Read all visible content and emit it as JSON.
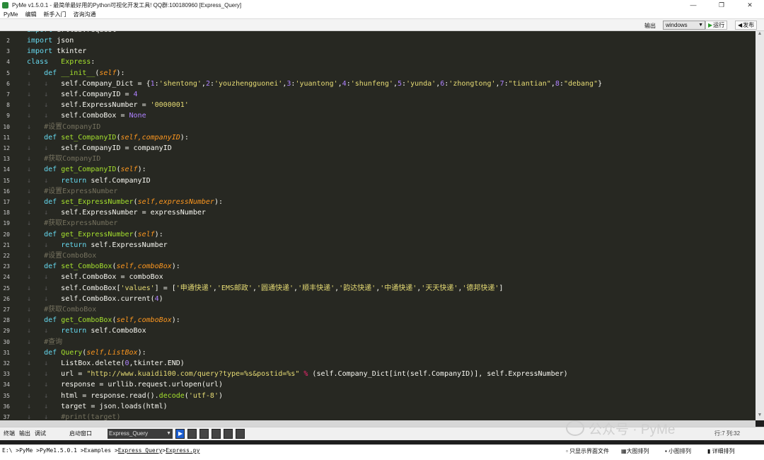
{
  "window": {
    "title": "PyMe v1.5.0.1 - 最简单最好用的Python可视化开发工具! QQ群:100180960   [Express_Query]",
    "minimize": "—",
    "maximize": "❐",
    "close": "✕"
  },
  "menu": [
    "PyMe",
    "编辑",
    "新手入门",
    "咨询沟通"
  ],
  "toolbar": {
    "output_label": "输出",
    "platform": "windows",
    "run_label": "运行",
    "publish_label": "发布"
  },
  "code_lines": [
    {
      "n": "2",
      "indent": 0,
      "html": "<span class='tok-kw'>import</span> json"
    },
    {
      "n": "3",
      "indent": 0,
      "html": "<span class='tok-kw'>import</span> tkinter"
    },
    {
      "n": "4",
      "indent": 0,
      "html": "<span class='tok-kw'>class</span>   <span class='tok-fn'>Express</span>:"
    },
    {
      "n": "5",
      "indent": 1,
      "html": "<span class='tok-kw'>def</span> <span class='tok-fn'>__init__</span>(<span class='tok-self'>self</span>):"
    },
    {
      "n": "6",
      "indent": 2,
      "html": "self.Company_Dict = {<span class='tok-num'>1</span>:<span class='tok-str'>'shentong'</span>,<span class='tok-num'>2</span>:<span class='tok-str'>'youzhengguonei'</span>,<span class='tok-num'>3</span>:<span class='tok-str'>'yuantong'</span>,<span class='tok-num'>4</span>:<span class='tok-str'>'shunfeng'</span>,<span class='tok-num'>5</span>:<span class='tok-str'>'yunda'</span>,<span class='tok-num'>6</span>:<span class='tok-str'>'zhongtong'</span>,<span class='tok-num'>7</span>:<span class='tok-str'>\"tiantian\"</span>,<span class='tok-num'>8</span>:<span class='tok-str'>\"debang\"</span>}"
    },
    {
      "n": "7",
      "indent": 2,
      "html": "self.CompanyID = <span class='tok-num'>4</span>"
    },
    {
      "n": "8",
      "indent": 2,
      "html": "self.ExpressNumber = <span class='tok-str'>'0000001'</span>"
    },
    {
      "n": "9",
      "indent": 2,
      "html": "self.ComboBox = <span class='tok-num'>None</span>"
    },
    {
      "n": "10",
      "indent": 1,
      "html": "<span class='tok-cm'>#设置CompanyID</span>"
    },
    {
      "n": "11",
      "indent": 1,
      "html": "<span class='tok-kw'>def</span> <span class='tok-fn'>set_CompanyID</span>(<span class='tok-self'>self,companyID</span>):"
    },
    {
      "n": "12",
      "indent": 2,
      "html": "self.CompanyID = companyID"
    },
    {
      "n": "13",
      "indent": 1,
      "html": "<span class='tok-cm'>#获取CompanyID</span>"
    },
    {
      "n": "14",
      "indent": 1,
      "html": "<span class='tok-kw'>def</span> <span class='tok-fn'>get_CompanyID</span>(<span class='tok-self'>self</span>):"
    },
    {
      "n": "15",
      "indent": 2,
      "html": "<span class='tok-kw'>return</span> self.CompanyID"
    },
    {
      "n": "16",
      "indent": 1,
      "html": "<span class='tok-cm'>#设置ExpressNumber</span>"
    },
    {
      "n": "17",
      "indent": 1,
      "html": "<span class='tok-kw'>def</span> <span class='tok-fn'>set_ExpressNumber</span>(<span class='tok-self'>self,expressNumber</span>):"
    },
    {
      "n": "18",
      "indent": 2,
      "html": "self.ExpressNumber = expressNumber"
    },
    {
      "n": "19",
      "indent": 1,
      "html": "<span class='tok-cm'>#获取ExpressNumber</span>"
    },
    {
      "n": "20",
      "indent": 1,
      "html": "<span class='tok-kw'>def</span> <span class='tok-fn'>get_ExpressNumber</span>(<span class='tok-self'>self</span>):"
    },
    {
      "n": "21",
      "indent": 2,
      "html": "<span class='tok-kw'>return</span> self.ExpressNumber"
    },
    {
      "n": "22",
      "indent": 1,
      "html": "<span class='tok-cm'>#设置ComboBox</span>"
    },
    {
      "n": "23",
      "indent": 1,
      "html": "<span class='tok-kw'>def</span> <span class='tok-fn'>set_ComboBox</span>(<span class='tok-self'>self,comboBox</span>):"
    },
    {
      "n": "24",
      "indent": 2,
      "html": "self.ComboBox = comboBox"
    },
    {
      "n": "25",
      "indent": 2,
      "html": "self.ComboBox[<span class='tok-str'>'values'</span>] = [<span class='tok-str'>'申通快递'</span>,<span class='tok-str'>'EMS邮政'</span>,<span class='tok-str'>'圆通快递'</span>,<span class='tok-str'>'顺丰快递'</span>,<span class='tok-str'>'韵达快递'</span>,<span class='tok-str'>'中通快递'</span>,<span class='tok-str'>'天天快递'</span>,<span class='tok-str'>'德邦快递'</span>]"
    },
    {
      "n": "26",
      "indent": 2,
      "html": "self.ComboBox.current(<span class='tok-num'>4</span>)"
    },
    {
      "n": "27",
      "indent": 1,
      "html": "<span class='tok-cm'>#获取ComboBox</span>"
    },
    {
      "n": "28",
      "indent": 1,
      "html": "<span class='tok-kw'>def</span> <span class='tok-fn'>get_ComboBox</span>(<span class='tok-self'>self,comboBox</span>):"
    },
    {
      "n": "29",
      "indent": 2,
      "html": "<span class='tok-kw'>return</span> self.ComboBox"
    },
    {
      "n": "30",
      "indent": 1,
      "html": "<span class='tok-cm'>#查询</span>"
    },
    {
      "n": "31",
      "indent": 1,
      "html": "<span class='tok-kw'>def</span> <span class='tok-fn'>Query</span>(<span class='tok-self'>self,ListBox</span>):"
    },
    {
      "n": "32",
      "indent": 2,
      "html": "ListBox.delete(<span class='tok-num'>0</span>,tkinter.END)"
    },
    {
      "n": "33",
      "indent": 2,
      "html": "url = <span class='tok-str'>\"http://www.kuaidi100.com/query?type=%s&amp;postid=%s\"</span> <span class='tok-op'>%</span> (self.Company_Dict[int(self.CompanyID)], self.ExpressNumber)"
    },
    {
      "n": "34",
      "indent": 2,
      "html": "response = urllib.request.urlopen(url)"
    },
    {
      "n": "35",
      "indent": 2,
      "html": "html = response.read().<span class='tok-fn'>decode</span>(<span class='tok-str'>'utf-8'</span>)"
    },
    {
      "n": "36",
      "indent": 2,
      "html": "target = json.loads(html)"
    },
    {
      "n": "37",
      "indent": 2,
      "html": "<span class='tok-cm'>#print(target)</span>"
    }
  ],
  "bottom_panel": {
    "tabs": [
      "终端",
      "输出",
      "调试"
    ],
    "run_window_label": "启动窗口",
    "run_window_value": "Express_Query",
    "cursor_position": "行:7 列:32"
  },
  "watermark": "公众号 · PyMe",
  "statusbar": {
    "path_prefix": "E:\\ >PyMe >PyMe1.5.0.1 >Examples >",
    "path_link1": "Express_Query",
    "path_sep": " >",
    "path_link2": "Express.py",
    "opt_filter": "只显示界面文件",
    "opt_large": "大图排列",
    "opt_small": "小图排列",
    "opt_detail": "详细排列"
  }
}
